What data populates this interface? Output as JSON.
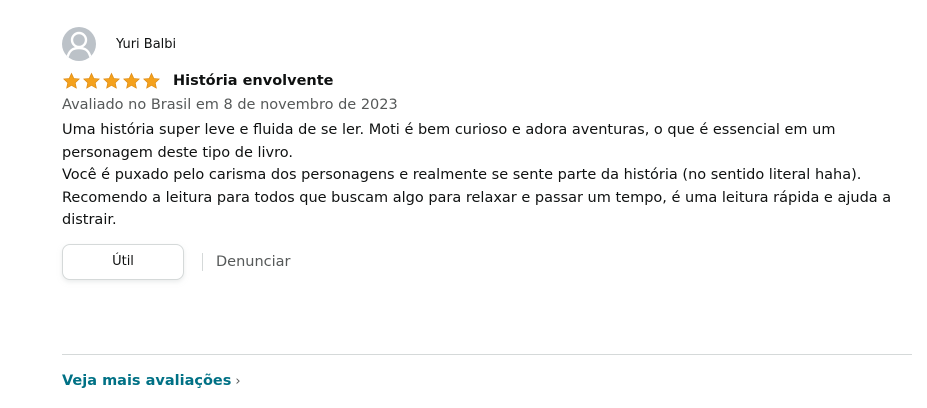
{
  "review": {
    "profile": {
      "name": "Yuri Balbi",
      "avatar_icon": "default-user-avatar-icon"
    },
    "rating": {
      "stars": 5,
      "max": 5,
      "star_color": "#f4a11d"
    },
    "title": "História envolvente",
    "date": "Avaliado no Brasil em 8 de novembro de 2023",
    "body": [
      "Uma história super leve e fluida de se ler. Moti é bem curioso e adora aventuras, o que é essencial em um personagem deste tipo de livro.",
      "Você é puxado pelo carisma dos personagens e realmente se sente parte da história (no sentido literal haha).",
      "Recomendo a leitura para todos que buscam algo para relaxar e passar um tempo, é uma leitura rápida e ajuda a distrair."
    ],
    "actions": {
      "helpful_label": "Útil",
      "report_label": "Denunciar"
    }
  },
  "footer": {
    "more_reviews_label": "Veja mais avaliações",
    "chevron": "›"
  },
  "colors": {
    "text": "#0f1111",
    "secondary_text": "#565959",
    "link": "#007185",
    "border": "#d5d9d9"
  }
}
